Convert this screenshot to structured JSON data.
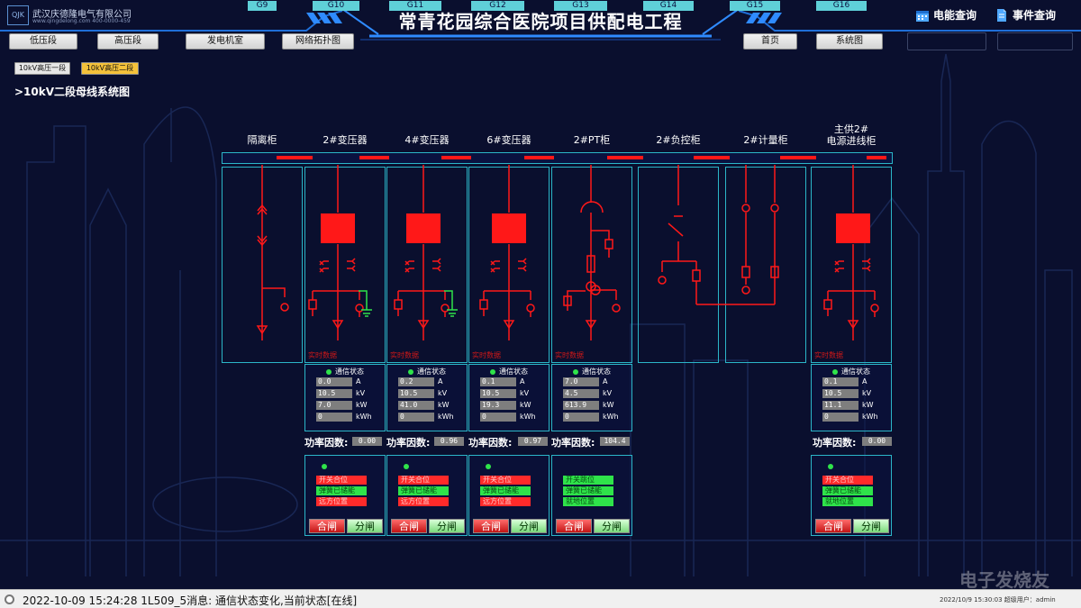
{
  "header": {
    "logo_text": "QJK",
    "company": "武汉庆德隆电气有限公司",
    "company_sub": "www.qingdelong.com   400-0000-459",
    "title": "常青花园综合医院项目供配电工程",
    "energy_query": "电能查询",
    "event_query": "事件查询"
  },
  "nav": {
    "left": [
      "低压段",
      "高压段",
      "发电机室",
      "网络拓扑图"
    ],
    "right": [
      "首页",
      "系统图"
    ]
  },
  "segments": [
    {
      "label": "10kV高压一段",
      "active": false
    },
    {
      "label": "10kV高压二段",
      "active": true
    }
  ],
  "system_title": ">10kV二段母线系统图",
  "realtime_label": "实时数据",
  "status_label": "通信状态",
  "pf_label": "功率因数:",
  "close_label": "合闸",
  "open_label": "分闸",
  "cabinets": [
    {
      "name": "隔离柜",
      "tag": "G9"
    },
    {
      "name": "2#变压器",
      "tag": "G10"
    },
    {
      "name": "4#变压器",
      "tag": "G11"
    },
    {
      "name": "6#变压器",
      "tag": "G12"
    },
    {
      "name": "2#PT柜",
      "tag": "G13"
    },
    {
      "name": "2#负控柜",
      "tag": "G14"
    },
    {
      "name": "2#计量柜",
      "tag": "G15"
    },
    {
      "name": "主供2#\n电源进线柜",
      "tag": "G16"
    }
  ],
  "meters": [
    {
      "cab": "G10",
      "values": [
        [
          "0.0",
          "A"
        ],
        [
          "10.5",
          "kV"
        ],
        [
          "7.0",
          "kW"
        ],
        [
          "0",
          "kWh"
        ]
      ],
      "pf": "0.00",
      "indicators": [
        [
          "开关合位",
          "red"
        ],
        [
          "弹簧已储能",
          "green"
        ],
        [
          "远方位置",
          "red"
        ]
      ]
    },
    {
      "cab": "G11",
      "values": [
        [
          "0.2",
          "A"
        ],
        [
          "10.5",
          "kV"
        ],
        [
          "41.0",
          "kW"
        ],
        [
          "0",
          "kWh"
        ]
      ],
      "pf": "0.96",
      "indicators": [
        [
          "开关合位",
          "red"
        ],
        [
          "弹簧已储能",
          "green"
        ],
        [
          "远方位置",
          "red"
        ]
      ]
    },
    {
      "cab": "G12",
      "values": [
        [
          "0.1",
          "A"
        ],
        [
          "10.5",
          "kV"
        ],
        [
          "19.3",
          "kW"
        ],
        [
          "0",
          "kWh"
        ]
      ],
      "pf": "0.97",
      "indicators": [
        [
          "开关合位",
          "red"
        ],
        [
          "弹簧已储能",
          "green"
        ],
        [
          "远方位置",
          "red"
        ]
      ]
    },
    {
      "cab": "G13",
      "values": [
        [
          "7.0",
          "A"
        ],
        [
          "4.5",
          "kV"
        ],
        [
          "613.9",
          "kW"
        ],
        [
          "0",
          "kWh"
        ]
      ],
      "pf": "104.4",
      "indicators": [
        [
          "开关跳位",
          "green"
        ],
        [
          "弹簧已储能",
          "green"
        ],
        [
          "就地位置",
          "green"
        ]
      ]
    },
    {
      "cab": "G16",
      "values": [
        [
          "0.1",
          "A"
        ],
        [
          "10.5",
          "kV"
        ],
        [
          "11.1",
          "kW"
        ],
        [
          "0",
          "kWh"
        ]
      ],
      "pf": "0.00",
      "indicators": [
        [
          "开关合位",
          "red"
        ],
        [
          "弹簧已储能",
          "green"
        ],
        [
          "就地位置",
          "green"
        ]
      ]
    }
  ],
  "statusbar": {
    "message": "2022-10-09 15:24:28   1L509_5消息:   通信状态变化,当前状态[在线]",
    "right": "2022/10/9 15:30:03   超级用户：admin"
  },
  "watermark": "电子发烧友",
  "colors": {
    "bg": "#0a0f2e",
    "frame": "#2bb6c8",
    "live": "#ff1818",
    "ok": "#2fe34a",
    "tag": "#5fd0d8",
    "active_segment": "#f5c23a"
  }
}
